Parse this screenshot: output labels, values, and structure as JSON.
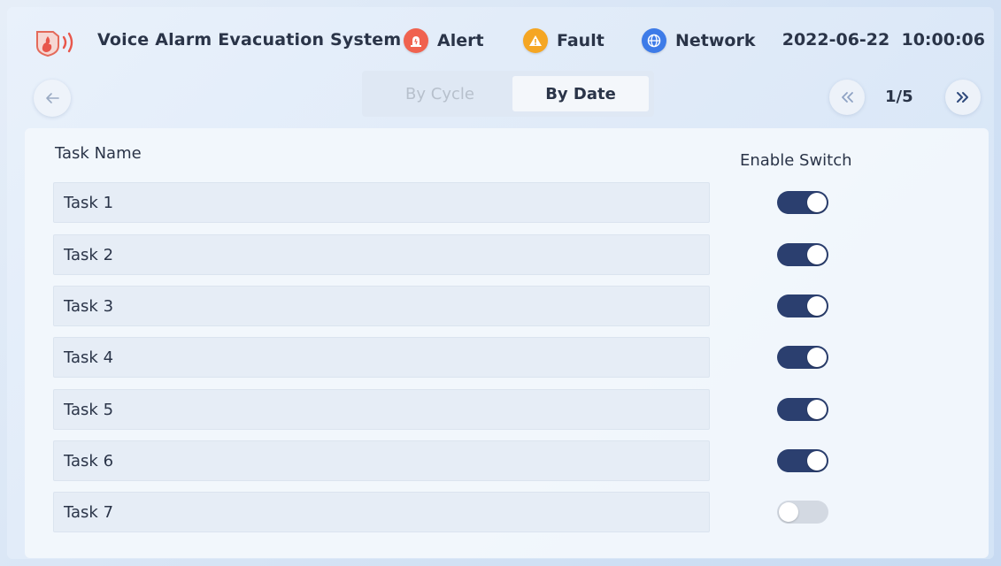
{
  "header": {
    "title": "Voice Alarm Evacuation System",
    "status": [
      {
        "label": "Alert",
        "icon": "alarm-siren-icon",
        "color": "#f0624f"
      },
      {
        "label": "Fault",
        "icon": "warning-triangle-icon",
        "color": "#f5a623"
      },
      {
        "label": "Network",
        "icon": "globe-icon",
        "color": "#3d7be8"
      }
    ],
    "datetime": "2022-06-22  10:00:06"
  },
  "toolbar": {
    "tabs": [
      {
        "label": "By Cycle",
        "active": false
      },
      {
        "label": "By Date",
        "active": true
      }
    ],
    "pager": "1/5"
  },
  "table": {
    "columns": {
      "task_name": "Task Name",
      "enable_switch": "Enable Switch"
    },
    "rows": [
      {
        "name": "Task 1",
        "enabled": true
      },
      {
        "name": "Task 2",
        "enabled": true
      },
      {
        "name": "Task 3",
        "enabled": true
      },
      {
        "name": "Task 4",
        "enabled": true
      },
      {
        "name": "Task 5",
        "enabled": true
      },
      {
        "name": "Task 6",
        "enabled": true
      },
      {
        "name": "Task 7",
        "enabled": false
      }
    ]
  },
  "colors": {
    "toggle_on": "#2b3f6f",
    "toggle_off": "#d3d9e2",
    "accent_text": "#2a3448"
  }
}
